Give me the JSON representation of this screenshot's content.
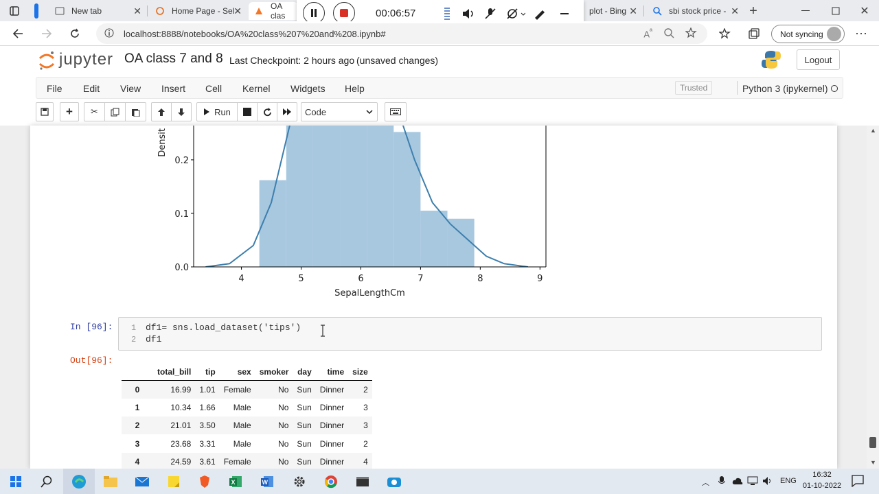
{
  "browser": {
    "tabs": [
      {
        "title": "New tab"
      },
      {
        "title": "Home Page - Sel"
      },
      {
        "title": "OA clas"
      },
      {
        "title": "plot - Bing"
      },
      {
        "title": "sbi stock price -"
      }
    ],
    "url": "localhost:8888/notebooks/OA%20class%207%20and%208.ipynb#",
    "sync_label": "Not syncing"
  },
  "media": {
    "timer": "00:06:57"
  },
  "jupyter": {
    "logo": "jupyter",
    "notebook_name": "OA class 7 and 8",
    "checkpoint": "Last Checkpoint: 2 hours ago",
    "unsaved": "(unsaved changes)",
    "logout": "Logout",
    "menu": [
      "File",
      "Edit",
      "View",
      "Insert",
      "Cell",
      "Kernel",
      "Widgets",
      "Help"
    ],
    "trusted": "Trusted",
    "kernel": "Python 3 (ipykernel)",
    "run_label": "Run",
    "cell_type": "Code"
  },
  "chart_data": {
    "type": "bar",
    "xlabel": "SepalLengthCm",
    "ylabel": "Densit",
    "x_ticks": [
      "4",
      "5",
      "6",
      "7",
      "8",
      "9"
    ],
    "y_ticks": [
      "0.0",
      "0.1",
      "0.2"
    ],
    "xlim": [
      3.2,
      9.1
    ],
    "ylim": [
      0.0,
      0.264
    ],
    "bins": [
      {
        "x0": 4.3,
        "x1": 4.75,
        "density": 0.162
      },
      {
        "x0": 4.75,
        "x1": 5.2,
        "density": 0.3
      },
      {
        "x0": 5.2,
        "x1": 5.65,
        "density": 0.3
      },
      {
        "x0": 5.65,
        "x1": 6.1,
        "density": 0.3
      },
      {
        "x0": 6.1,
        "x1": 6.55,
        "density": 0.3
      },
      {
        "x0": 6.55,
        "x1": 7.0,
        "density": 0.252
      },
      {
        "x0": 7.0,
        "x1": 7.45,
        "density": 0.105
      },
      {
        "x0": 7.45,
        "x1": 7.9,
        "density": 0.09
      }
    ],
    "kde": {
      "x": [
        3.4,
        3.8,
        4.2,
        4.5,
        4.8,
        5.1,
        5.4,
        5.7,
        6.0,
        6.3,
        6.6,
        6.9,
        7.2,
        7.5,
        7.8,
        8.1,
        8.4,
        8.8
      ],
      "y": [
        0.0,
        0.006,
        0.04,
        0.12,
        0.26,
        0.39,
        0.44,
        0.42,
        0.38,
        0.35,
        0.3,
        0.2,
        0.12,
        0.08,
        0.05,
        0.02,
        0.006,
        0.0
      ]
    },
    "colors": {
      "bars": "#a8c8e0",
      "kde": "#3d7fad"
    }
  },
  "cell": {
    "in_prompt": "In [96]:",
    "out_prompt": "Out[96]:",
    "lines": [
      "df1= sns.load_dataset('tips')",
      "df1"
    ]
  },
  "table": {
    "columns": [
      "",
      "total_bill",
      "tip",
      "sex",
      "smoker",
      "day",
      "time",
      "size"
    ],
    "rows": [
      [
        "0",
        "16.99",
        "1.01",
        "Female",
        "No",
        "Sun",
        "Dinner",
        "2"
      ],
      [
        "1",
        "10.34",
        "1.66",
        "Male",
        "No",
        "Sun",
        "Dinner",
        "3"
      ],
      [
        "2",
        "21.01",
        "3.50",
        "Male",
        "No",
        "Sun",
        "Dinner",
        "3"
      ],
      [
        "3",
        "23.68",
        "3.31",
        "Male",
        "No",
        "Sun",
        "Dinner",
        "2"
      ],
      [
        "4",
        "24.59",
        "3.61",
        "Female",
        "No",
        "Sun",
        "Dinner",
        "4"
      ]
    ]
  },
  "taskbar": {
    "lang": "ENG",
    "time": "16:32",
    "date": "01-10-2022"
  }
}
